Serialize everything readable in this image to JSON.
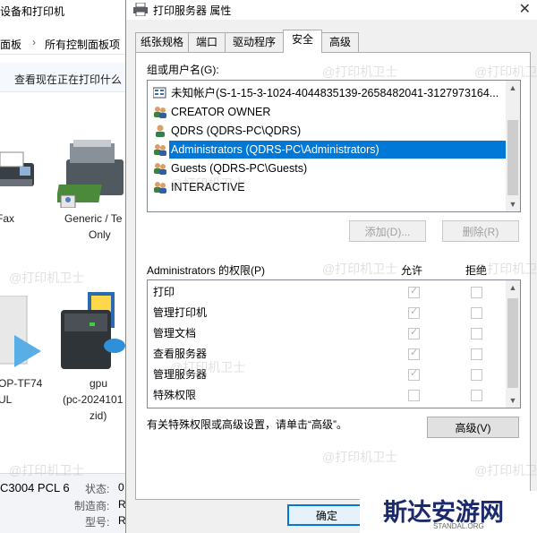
{
  "background_window": {
    "title": "设备和打印机",
    "address_bar": [
      "面板",
      "所有控制面板项"
    ],
    "command": "查看现在正在打印什么",
    "devices": [
      {
        "label": "Fax",
        "icon": "fax-icon"
      },
      {
        "label": "Generic / Te",
        "label2": "Only",
        "icon": "printer-icon"
      },
      {
        "label": "OP-TF74",
        "label2": "UL",
        "icon": "computer-icon"
      },
      {
        "label": "gpu",
        "label2": "(pc-2024101",
        "label3": "zid)",
        "icon": "drive-icon"
      }
    ],
    "status_pane": {
      "model": "C3004 PCL 6",
      "state_label": "状态:",
      "maker_label": "制造商:",
      "model_label": "型号:",
      "state_value": "0",
      "maker_value": "R",
      "model_value": "R"
    }
  },
  "dialog": {
    "title": "打印服务器 属性",
    "close_label": "✕",
    "tabs": [
      {
        "label": "纸张规格",
        "active": false
      },
      {
        "label": "端口",
        "active": false
      },
      {
        "label": "驱动程序",
        "active": false
      },
      {
        "label": "安全",
        "active": true
      },
      {
        "label": "高级",
        "active": false
      }
    ],
    "groups_label": "组或用户名(G):",
    "users": [
      {
        "name": "未知帐户(S-1-15-3-1024-4044835139-2658482041-3127973164...",
        "icon": "unknown-account-icon",
        "selected": false
      },
      {
        "name": "CREATOR OWNER",
        "icon": "users-icon",
        "selected": false
      },
      {
        "name": "QDRS (QDRS-PC\\QDRS)",
        "icon": "user-icon",
        "selected": false
      },
      {
        "name": "Administrators (QDRS-PC\\Administrators)",
        "icon": "users-icon",
        "selected": true
      },
      {
        "name": "Guests (QDRS-PC\\Guests)",
        "icon": "users-icon",
        "selected": false
      },
      {
        "name": "INTERACTIVE",
        "icon": "users-icon",
        "selected": false
      }
    ],
    "add_button": "添加(D)...",
    "remove_button": "删除(R)",
    "perm_label": "Administrators 的权限(P)",
    "allow_header": "允许",
    "deny_header": "拒绝",
    "permissions": [
      {
        "name": "打印",
        "allow": true,
        "deny": false
      },
      {
        "name": "管理打印机",
        "allow": true,
        "deny": false
      },
      {
        "name": "管理文档",
        "allow": true,
        "deny": false
      },
      {
        "name": "查看服务器",
        "allow": true,
        "deny": false
      },
      {
        "name": "管理服务器",
        "allow": true,
        "deny": false
      },
      {
        "name": "特殊权限",
        "allow": false,
        "deny": false
      }
    ],
    "advanced_hint": "有关特殊权限或高级设置，请单击“高级”。",
    "advanced_button": "高级(V)",
    "ok_button": "确定"
  },
  "watermark": "@打印机卫士",
  "logo": {
    "text": "斯达安游网",
    "sub": "STANDAL.ORG"
  },
  "colors": {
    "selection": "#0078d7",
    "dialog_bg": "#f0f0f0"
  }
}
